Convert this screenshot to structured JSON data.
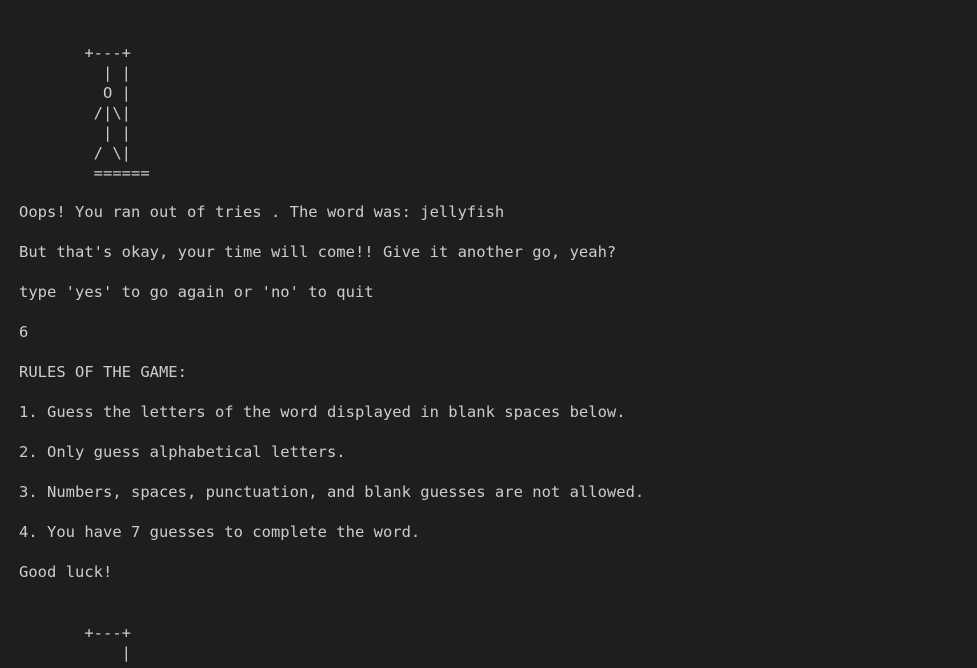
{
  "terminal": {
    "hangman_full": [
      "       +---+",
      "         | |",
      "         O |",
      "        /|\\|",
      "         | |",
      "        / \\|",
      "        ======"
    ],
    "lose_message": "Oops! You ran out of tries . The word was: jellyfish",
    "encouragement": "But that's okay, your time will come!! Give it another go, yeah?",
    "play_again_prompt": "type 'yes' to go again or 'no' to quit",
    "user_input": "6",
    "rules_header": "RULES OF THE GAME:",
    "rules": [
      "1. Guess the letters of the word displayed in blank spaces below.",
      "2. Only guess alphabetical letters.",
      "3. Numbers, spaces, punctuation, and blank guesses are not allowed.",
      "4. You have 7 guesses to complete the word."
    ],
    "good_luck": "Good luck!",
    "hangman_new": [
      "       +---+",
      "           |"
    ]
  }
}
